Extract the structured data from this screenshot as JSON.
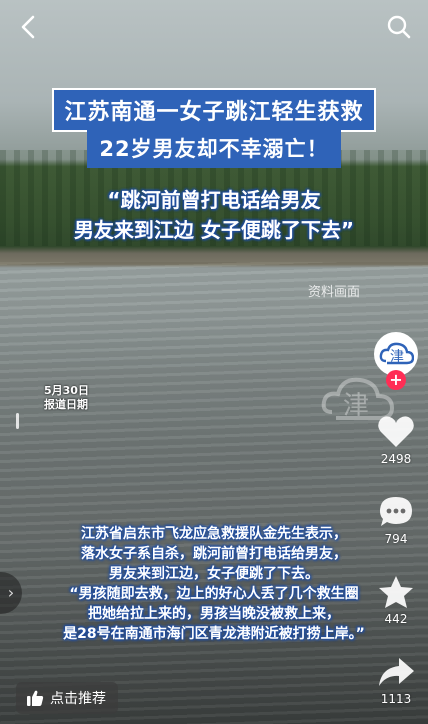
{
  "topbar": {
    "back_icon": "chevron-left-icon",
    "search_icon": "search-icon"
  },
  "video": {
    "headline1": "江苏南通一女子跳江轻生获救",
    "headline2": "22岁男友却不幸溺亡！",
    "quote_line1": "“跳河前曾打电话给男友",
    "quote_line2": "男友来到江边 女子便跳了下去”",
    "source_label": "资料画面",
    "date_line1": "5月30日",
    "date_line2": "报道日期",
    "caption_lines": [
      "江苏省启东市飞龙应急救援队金先生表示，",
      "落水女子系自杀，跳河前曾打电话给男友，",
      "男友来到江边，女子便跳了下去。",
      "“男孩随即去救，边上的好心人丢了几个救生圈",
      "把她给拉上来的，男孩当晚没被救上来，",
      "是28号在南通市海门区青龙港附近被打捞上岸。”"
    ]
  },
  "rail": {
    "avatar_glyph": "津",
    "follow_plus": "+",
    "likes": "2498",
    "comments": "794",
    "favorites": "442",
    "shares": "1113"
  },
  "bottom": {
    "recommend_label": "点击推荐"
  },
  "colors": {
    "banner_blue": "#2f63b8",
    "follow_red": "#ff2d55"
  }
}
